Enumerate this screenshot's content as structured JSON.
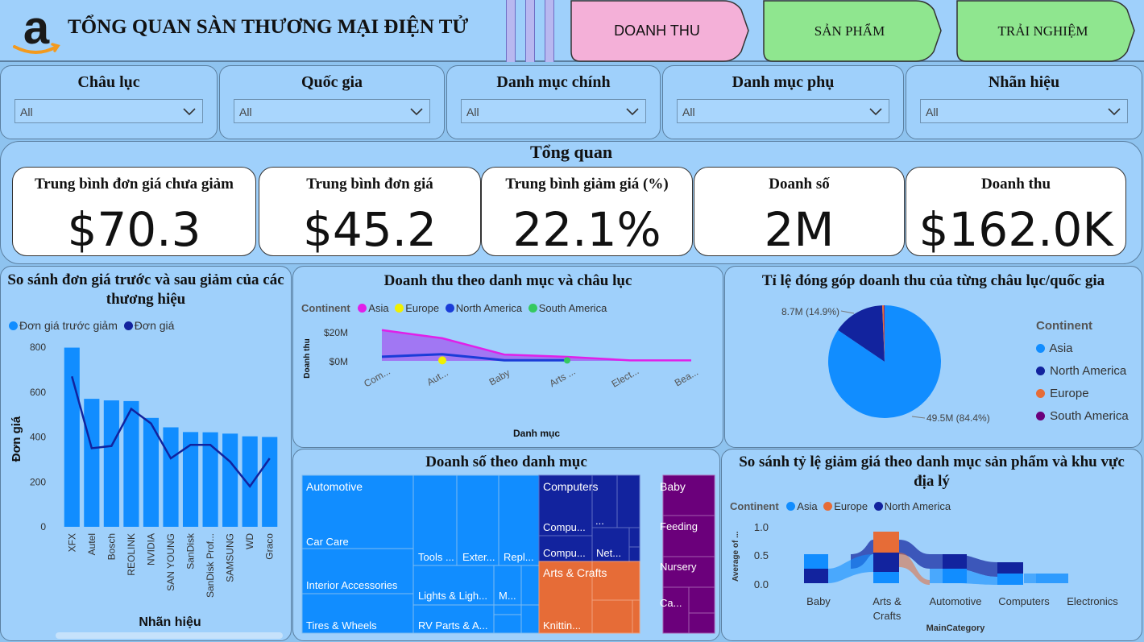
{
  "header": {
    "title": "TỔNG QUAN SÀN THƯƠNG MẠI ĐIỆN TỬ",
    "logo_icon": "amazon-logo-icon",
    "nav": [
      {
        "label": "DOANH THU",
        "color": "#f4b0d8"
      },
      {
        "label": "SẢN PHẨM",
        "color": "#8fe68f"
      },
      {
        "label": "TRẢI NGHIỆM",
        "color": "#8fe68f"
      }
    ]
  },
  "filters": [
    {
      "label": "Châu lục",
      "value": "All"
    },
    {
      "label": "Quốc gia",
      "value": "All"
    },
    {
      "label": "Danh mục chính",
      "value": "All"
    },
    {
      "label": "Danh mục phụ",
      "value": "All"
    },
    {
      "label": "Nhãn hiệu",
      "value": "All"
    }
  ],
  "overview": {
    "title": "Tổng quan",
    "kpis": [
      {
        "label": "Trung bình đơn giá chưa giảm",
        "value": "$70.3"
      },
      {
        "label": "Trung bình đơn giá",
        "value": "$45.2"
      },
      {
        "label": "Trung bình giảm giá (%)",
        "value": "22.1%"
      },
      {
        "label": "Doanh số",
        "value": "2M"
      },
      {
        "label": "Doanh thu",
        "value": "$162.0K"
      }
    ]
  },
  "chart_data": [
    {
      "type": "bar",
      "title": "So sánh đơn giá trước và sau giảm của các thương hiệu",
      "xlabel": "Nhãn hiệu",
      "ylabel": "Đơn giá",
      "categories": [
        "XFX",
        "Autel",
        "Bosch",
        "REOLINK",
        "NVIDIA",
        "SAN YOUNG",
        "SanDisk",
        "SanDisk Prof...",
        "SAMSUNG",
        "WD",
        "Graco"
      ],
      "ylim": [
        0,
        800
      ],
      "yticks": [
        "0",
        "200",
        "400",
        "600",
        "800"
      ],
      "series": [
        {
          "name": "Đơn giá trước giảm",
          "kind": "bar",
          "color": "#118dff",
          "values": [
            798,
            570,
            563,
            560,
            485,
            443,
            422,
            421,
            415,
            403,
            400
          ]
        },
        {
          "name": "Đơn giá",
          "kind": "line",
          "color": "#12239e",
          "values": [
            670,
            350,
            360,
            525,
            460,
            305,
            365,
            365,
            290,
            180,
            305
          ]
        }
      ]
    },
    {
      "type": "area",
      "title": "Doanh thu theo danh mục và châu lục",
      "xlabel": "Danh mục",
      "ylabel": "Doanh thu",
      "legend_title": "Continent",
      "categories": [
        "Com...",
        "Aut...",
        "Baby",
        "Arts ...",
        "Elect...",
        "Bea..."
      ],
      "yticks": [
        "$0M",
        "$20M"
      ],
      "ylim": [
        0,
        26
      ],
      "series": [
        {
          "name": "Asia",
          "color": "#e020e8",
          "values": [
            24.5,
            18,
            5,
            3.2,
            0.4,
            0.4
          ]
        },
        {
          "name": "Europe",
          "color": "#f0f000",
          "values": [
            null,
            0.4,
            null,
            null,
            null,
            null
          ]
        },
        {
          "name": "North America",
          "color": "#1a3cd8",
          "values": [
            3.3,
            5.3,
            0.5,
            0.5,
            null,
            null
          ]
        },
        {
          "name": "South America",
          "color": "#35c960",
          "values": [
            null,
            null,
            null,
            0.4,
            null,
            null
          ]
        }
      ]
    },
    {
      "type": "pie",
      "title": "Tỉ lệ đóng góp doanh thu của từng châu lục/quốc gia",
      "legend_title": "Continent",
      "slices": [
        {
          "name": "Asia",
          "value": 49.5,
          "label": "49.5M (84.4%)",
          "color": "#118dff"
        },
        {
          "name": "North America",
          "value": 8.7,
          "label": "8.7M (14.9%)",
          "color": "#12239e"
        },
        {
          "name": "Europe",
          "value": 0.3,
          "label": "",
          "color": "#e66c37"
        },
        {
          "name": "South America",
          "value": 0.1,
          "label": "",
          "color": "#6b007b"
        }
      ]
    }
  ],
  "treemap": {
    "title": "Doanh số theo danh mục",
    "labels": {
      "automotive": "Automotive",
      "car_care": "Car Care",
      "interior": "Interior Accessories",
      "tires": "Tires & Wheels",
      "tools": "Tools ...",
      "exter": "Exter...",
      "repl": "Repl...",
      "lights": "Lights & Ligh...",
      "m": "M...",
      "rv": "RV Parts & A...",
      "computers": "Computers",
      "compu1": "Compu...",
      "compu2": "Compu...",
      "ellipsis": "...",
      "net": "Net...",
      "arts": "Arts & Crafts",
      "knittin": "Knittin...",
      "baby": "Baby",
      "feeding": "Feeding",
      "nursery": "Nursery",
      "ca": "Ca..."
    },
    "colors": {
      "automotive": "#118dff",
      "computers": "#12239e",
      "arts": "#e66c37",
      "baby": "#6b007b"
    }
  },
  "ribbon": {
    "title": "So sánh tỷ lệ giảm giá theo danh mục sản phẩm và khu vực địa lý",
    "legend_title": "Continent",
    "legend": [
      {
        "name": "Asia",
        "color": "#118dff"
      },
      {
        "name": "Europe",
        "color": "#e66c37"
      },
      {
        "name": "North America",
        "color": "#12239e"
      }
    ],
    "ylabel": "Average of ...",
    "xlabel": "MainCategory",
    "yticks": [
      "1.0",
      "0.5",
      "0.0"
    ],
    "categories": [
      "Baby",
      "Arts &\nCrafts",
      "Automotive",
      "Computers",
      "Electronics"
    ]
  }
}
